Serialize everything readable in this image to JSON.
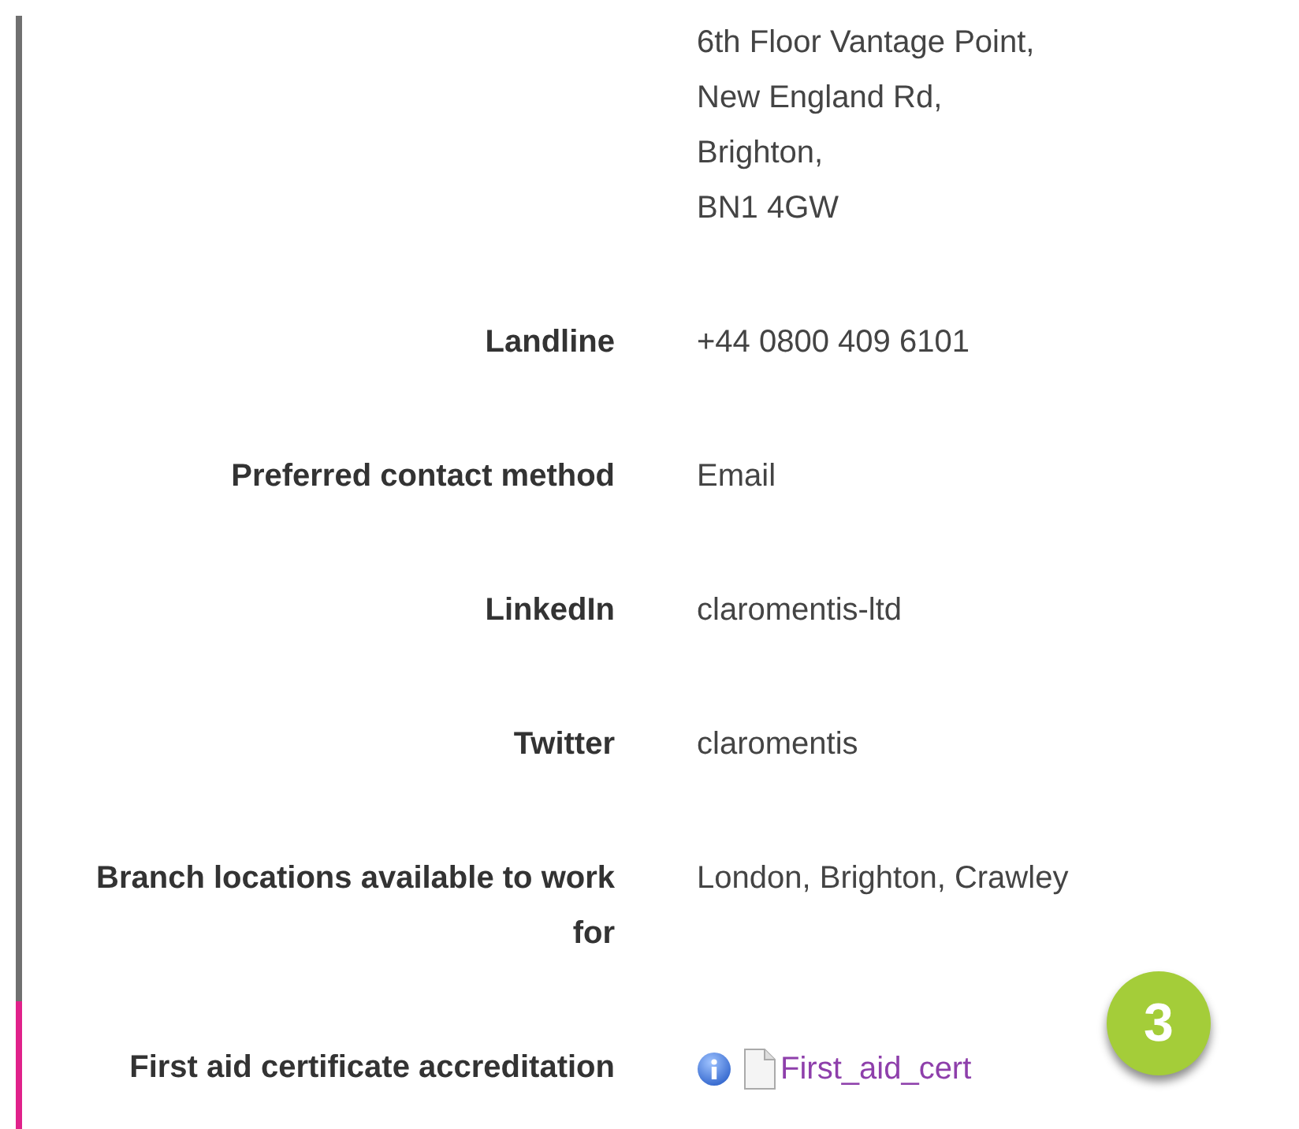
{
  "rows": [
    {
      "label": "",
      "kind": "lines",
      "values": [
        "6th Floor Vantage Point,",
        "New England Rd,",
        "Brighton,",
        "BN1 4GW"
      ],
      "highlighted": false
    },
    {
      "label": "Landline",
      "kind": "lines",
      "values": [
        "+44 0800 409 6101"
      ],
      "highlighted": false
    },
    {
      "label": "Preferred contact method",
      "kind": "lines",
      "values": [
        "Email"
      ],
      "highlighted": false
    },
    {
      "label": "LinkedIn",
      "kind": "lines",
      "values": [
        "claromentis-ltd"
      ],
      "highlighted": false
    },
    {
      "label": "Twitter",
      "kind": "lines",
      "values": [
        "claromentis"
      ],
      "highlighted": false
    },
    {
      "label": "Branch locations available to work for",
      "kind": "lines",
      "values": [
        "London, Brighton, Crawley"
      ],
      "highlighted": false
    },
    {
      "label": "First aid certificate accreditation",
      "kind": "file",
      "values": [
        "First_aid_cert"
      ],
      "highlighted": true
    }
  ],
  "badge": "3"
}
